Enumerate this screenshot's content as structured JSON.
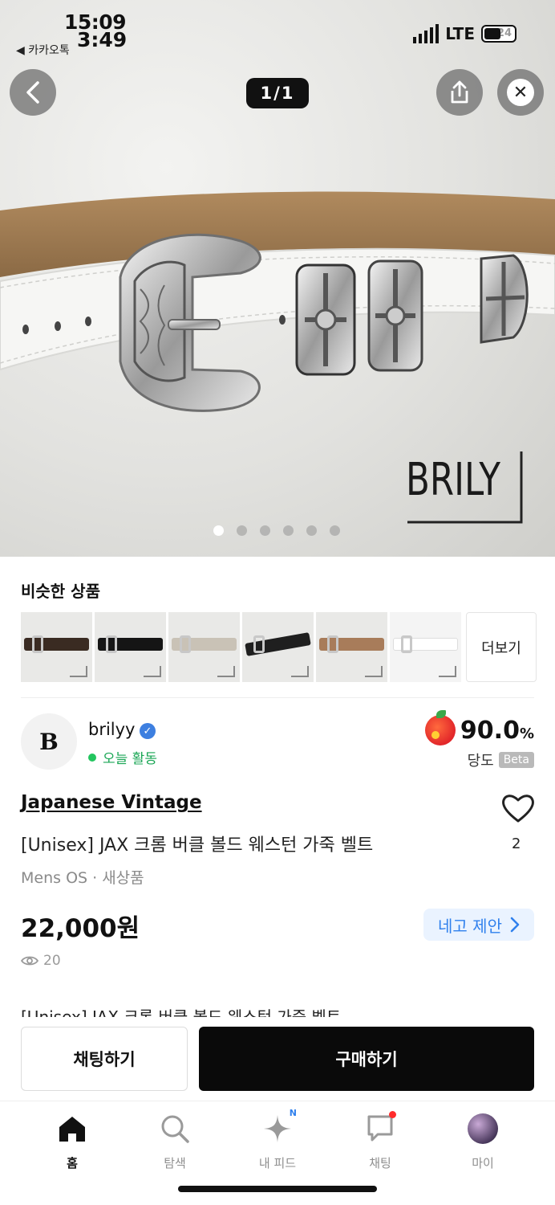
{
  "status_bar": {
    "time_top": "15:09",
    "time_bottom": "3:49",
    "back_app": "◀ 카카오톡",
    "network": "LTE",
    "battery": "24"
  },
  "gallery": {
    "counter": "1/1",
    "watermark": "BRILY",
    "dot_count": 6,
    "active_dot": 1
  },
  "similar": {
    "title": "비슷한 상품",
    "more_label": "더보기",
    "thumbnails": [
      {
        "name": "similar-item-1",
        "belt_color": "#3a2b22"
      },
      {
        "name": "similar-item-2",
        "belt_color": "#151515"
      },
      {
        "name": "similar-item-3",
        "belt_color": "#c9c2b6"
      },
      {
        "name": "similar-item-4",
        "belt_color": "#1f1f1f"
      },
      {
        "name": "similar-item-5",
        "belt_color": "#a87c5a"
      },
      {
        "name": "similar-item-6",
        "belt_color": "#f2f2f2"
      }
    ]
  },
  "seller": {
    "logo_letter": "B",
    "name": "brilyy",
    "status": "오늘 활동",
    "score": "90.0",
    "score_unit": "%",
    "score_label": "당도",
    "beta": "Beta"
  },
  "product": {
    "brand": "Japanese Vintage",
    "title": "[Unisex] JAX 크롬 버클 볼드 웨스턴 가죽 벨트",
    "meta": "Mens OS · 새상품",
    "likes": "2",
    "price": "22,000원",
    "nego_label": "네고 제안",
    "views": "20",
    "description_peek": "[Unisex] JAX 크롬 버클 볼드 웨스턴 가죽 벨트"
  },
  "actions": {
    "chat": "채팅하기",
    "buy": "구매하기"
  },
  "tabs": [
    {
      "label": "홈",
      "icon": "home-icon"
    },
    {
      "label": "탐색",
      "icon": "search-icon"
    },
    {
      "label": "내 피드",
      "icon": "sparkle-icon",
      "badge": "N"
    },
    {
      "label": "채팅",
      "icon": "chat-icon"
    },
    {
      "label": "마이",
      "icon": "avatar"
    }
  ],
  "colors": {
    "accent_blue": "#2f80ed",
    "online_green": "#22c55e",
    "buy_button": "#0a0a0a"
  }
}
